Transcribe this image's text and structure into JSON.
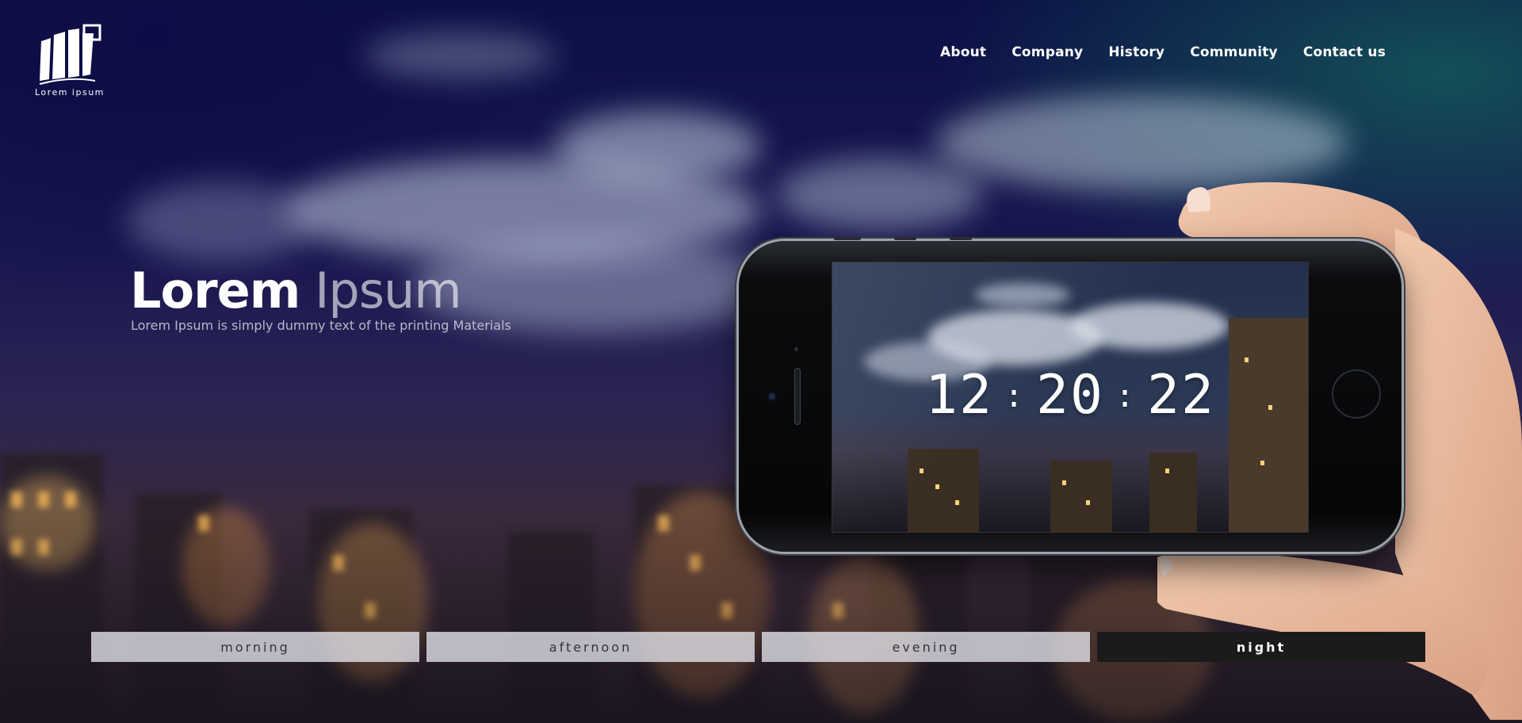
{
  "brand": {
    "logo_text": "Lorem ipsum"
  },
  "nav": {
    "items": [
      {
        "label": "About"
      },
      {
        "label": "Company"
      },
      {
        "label": "History"
      },
      {
        "label": "Community"
      },
      {
        "label": "Contact us"
      }
    ]
  },
  "hero": {
    "title_bold": "Lorem",
    "title_light": "Ipsum",
    "subtitle": "Lorem Ipsum is simply dummy text of the printing Materials"
  },
  "clock": {
    "hours": "12",
    "minutes": "20",
    "seconds": "22",
    "separator": ":"
  },
  "tabs": {
    "items": [
      {
        "label": "morning"
      },
      {
        "label": "afternoon"
      },
      {
        "label": "evening"
      },
      {
        "label": "night"
      }
    ],
    "active": "night"
  },
  "colors": {
    "nav_text": "#ffffff",
    "tab_inactive_bg": "#e1e1e8",
    "tab_active_bg": "#1b1b1b",
    "tab_active_text": "#ffffff"
  }
}
